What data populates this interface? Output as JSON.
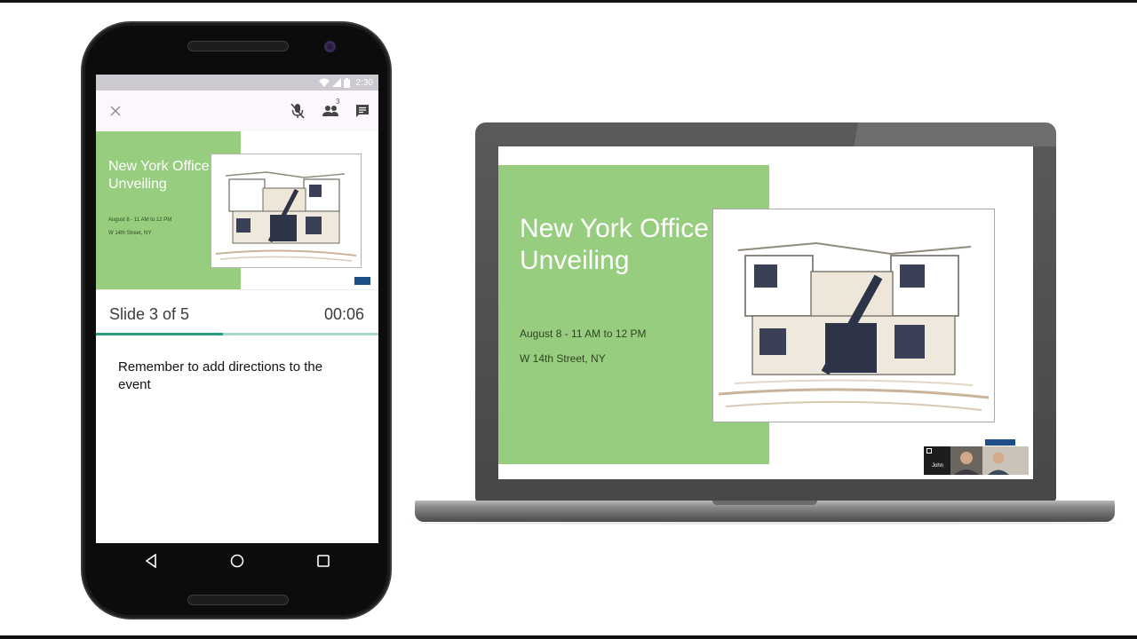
{
  "phone": {
    "status_bar": {
      "time": "2:30"
    },
    "app_bar": {
      "people_count": "3"
    },
    "slide": {
      "title": "New York Office Unveiling",
      "date": "August 8 - 11 AM to 12 PM",
      "address": "W 14th Street, NY"
    },
    "slide_counter": "Slide 3 of 5",
    "timer": "00:06",
    "progress": 0.45,
    "speaker_notes": "Remember to add directions to the event"
  },
  "laptop": {
    "slide": {
      "title": "New York Office Unveiling",
      "date": "August 8 - 11 AM to 12 PM",
      "address": "W 14th Street, NY"
    },
    "video_participants": [
      {
        "name": "John"
      },
      {
        "name": ""
      }
    ]
  },
  "colors": {
    "slide_green": "#97cd7e",
    "progress_accent": "#27a07f",
    "progress_track": "#a8d8cc",
    "logo_blue": "#1e4f89"
  },
  "icons": [
    "close-icon",
    "mic-off-icon",
    "people-icon",
    "chat-icon",
    "wifi-icon",
    "signal-icon",
    "battery-icon",
    "back-icon",
    "home-icon",
    "recents-icon"
  ]
}
